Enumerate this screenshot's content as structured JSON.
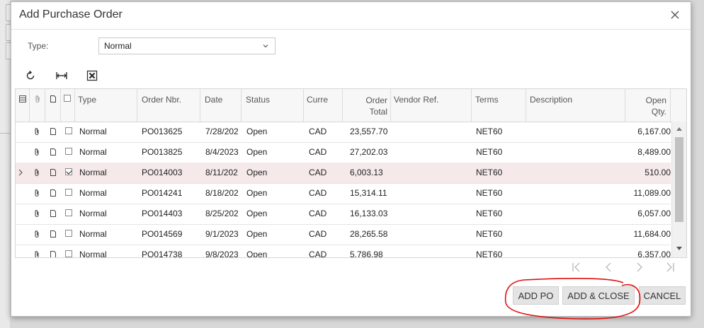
{
  "dialog": {
    "title": "Add Purchase Order",
    "close_icon": "close-icon"
  },
  "filter": {
    "type_label": "Type:",
    "type_value": "Normal"
  },
  "toolbar": {
    "refresh_icon": "refresh-icon",
    "fit_columns_icon": "fit-columns-icon",
    "export_excel_icon": "excel-export-icon"
  },
  "grid": {
    "headers": {
      "type": "Type",
      "order_nbr": "Order Nbr.",
      "date": "Date",
      "status": "Status",
      "currency": "Curre",
      "order_total_1": "Order",
      "order_total_2": "Total",
      "vendor_ref": "Vendor Ref.",
      "terms": "Terms",
      "description": "Description",
      "open_qty_1": "Open",
      "open_qty_2": "Qty."
    },
    "rows": [
      {
        "type": "Normal",
        "order_nbr": "PO013625",
        "date": "7/28/202",
        "status": "Open",
        "currency": "CAD",
        "order_total": "23,557.70",
        "vendor_ref": "",
        "terms": "NET60",
        "description": "",
        "open_qty": "6,167.00",
        "checked": false
      },
      {
        "type": "Normal",
        "order_nbr": "PO013825",
        "date": "8/4/2023",
        "status": "Open",
        "currency": "CAD",
        "order_total": "27,202.03",
        "vendor_ref": "",
        "terms": "NET60",
        "description": "",
        "open_qty": "8,489.00",
        "checked": false
      },
      {
        "type": "Normal",
        "order_nbr": "PO014003",
        "date": "8/11/202",
        "status": "Open",
        "currency": "CAD",
        "order_total": "6,003.13",
        "vendor_ref": "",
        "terms": "NET60",
        "description": "",
        "open_qty": "510.00",
        "checked": true
      },
      {
        "type": "Normal",
        "order_nbr": "PO014241",
        "date": "8/18/202",
        "status": "Open",
        "currency": "CAD",
        "order_total": "15,314.11",
        "vendor_ref": "",
        "terms": "NET60",
        "description": "",
        "open_qty": "11,089.00",
        "checked": false
      },
      {
        "type": "Normal",
        "order_nbr": "PO014403",
        "date": "8/25/202",
        "status": "Open",
        "currency": "CAD",
        "order_total": "16,133.03",
        "vendor_ref": "",
        "terms": "NET60",
        "description": "",
        "open_qty": "6,057.00",
        "checked": false
      },
      {
        "type": "Normal",
        "order_nbr": "PO014569",
        "date": "9/1/2023",
        "status": "Open",
        "currency": "CAD",
        "order_total": "28,265.58",
        "vendor_ref": "",
        "terms": "NET60",
        "description": "",
        "open_qty": "11,684.00",
        "checked": false
      },
      {
        "type": "Normal",
        "order_nbr": "PO014738",
        "date": "9/8/2023",
        "status": "Open",
        "currency": "CAD",
        "order_total": "5,786.98",
        "vendor_ref": "",
        "terms": "NET60",
        "description": "",
        "open_qty": "6,357.00",
        "checked": false
      }
    ]
  },
  "pager": {
    "first_icon": "first-page-icon",
    "prev_icon": "prev-page-icon",
    "next_icon": "next-page-icon",
    "last_icon": "last-page-icon"
  },
  "buttons": {
    "add_po": "ADD PO",
    "add_close": "ADD & CLOSE",
    "cancel": "CANCEL"
  },
  "colors": {
    "selected_row": "#f5e9e9",
    "annotation": "#e01010",
    "button_bg": "#e4e4e4"
  }
}
